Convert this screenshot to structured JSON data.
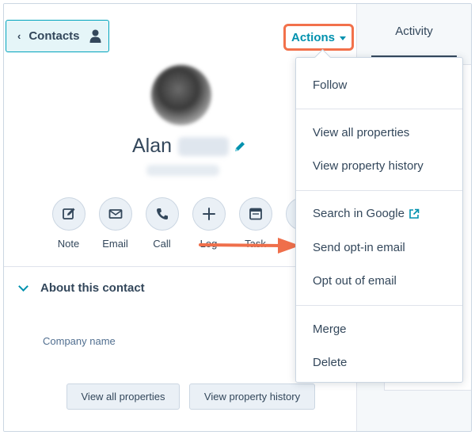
{
  "header": {
    "contacts_label": "Contacts",
    "actions_label": "Actions"
  },
  "contact": {
    "first_name": "Alan"
  },
  "quick_actions": [
    {
      "label": "Note",
      "icon": "note-icon"
    },
    {
      "label": "Email",
      "icon": "email-icon"
    },
    {
      "label": "Call",
      "icon": "phone-icon"
    },
    {
      "label": "Log",
      "icon": "plus-icon"
    },
    {
      "label": "Task",
      "icon": "task-icon"
    }
  ],
  "about": {
    "title": "About this contact",
    "company_label": "Company name",
    "view_all_label": "View all properties",
    "history_label": "View property history"
  },
  "sidebar": {
    "activity_tab": "Activity"
  },
  "dropdown": {
    "items": [
      "Follow",
      "View all properties",
      "View property history",
      "Search in Google",
      "Send opt-in email",
      "Opt out of email",
      "Merge",
      "Delete"
    ]
  },
  "colors": {
    "accent": "#0091ae",
    "highlight": "#f2714b",
    "text": "#33475b"
  }
}
